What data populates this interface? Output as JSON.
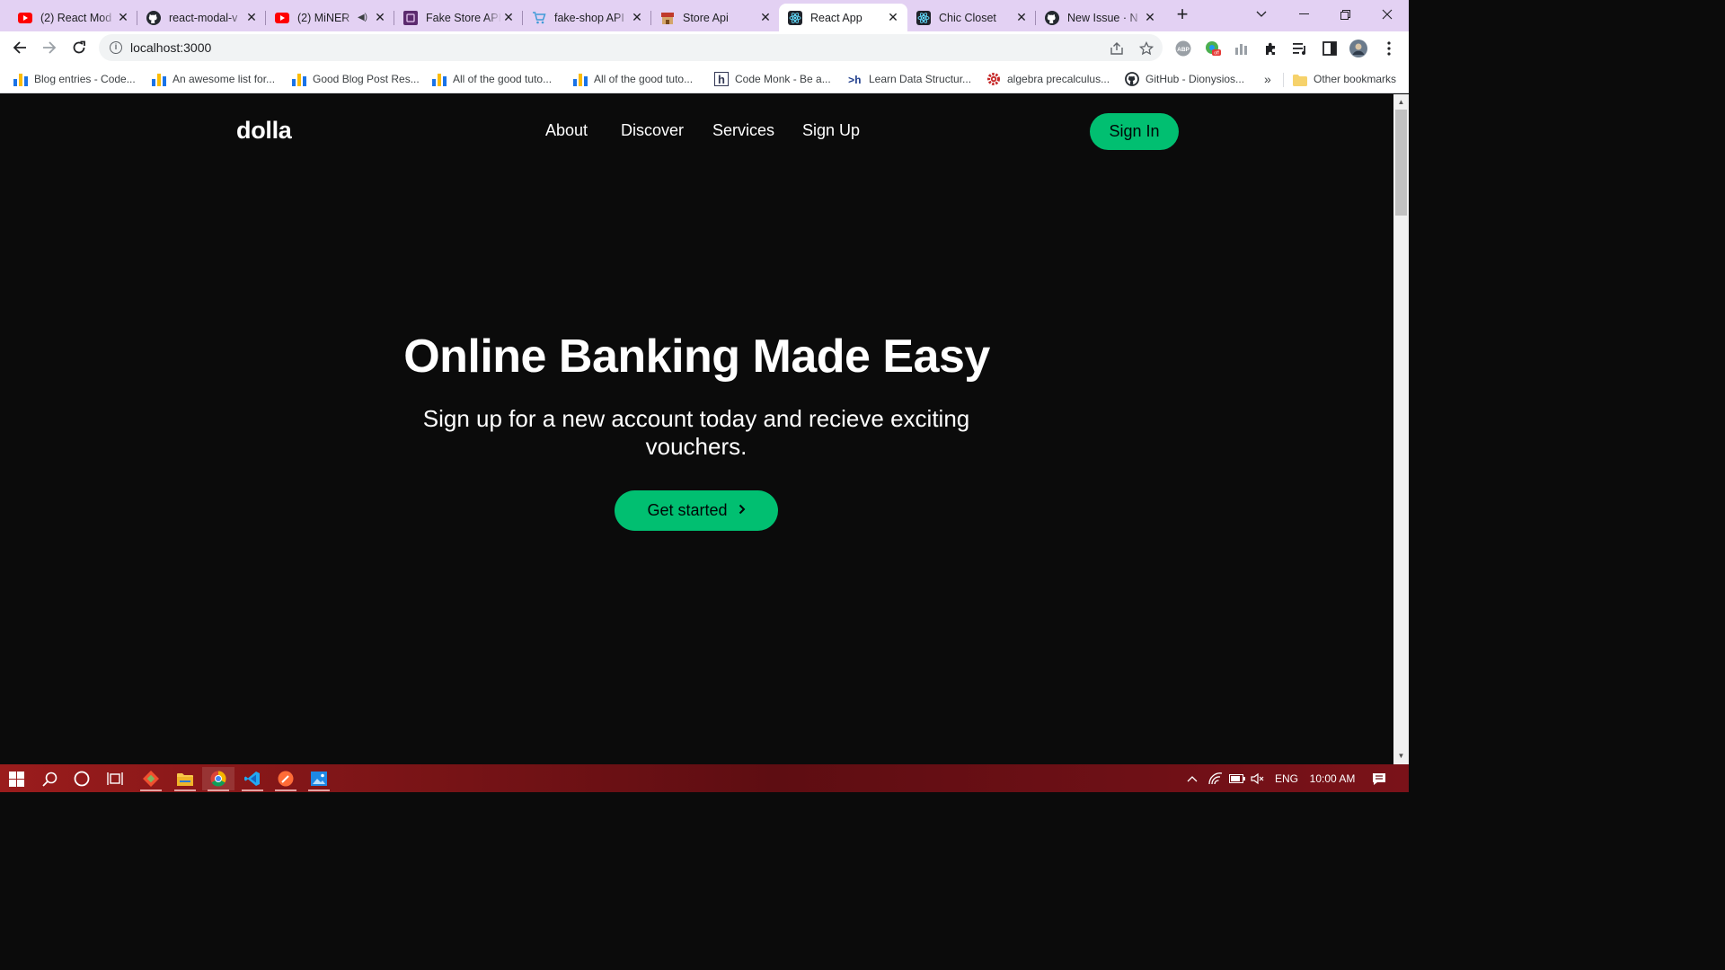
{
  "browser": {
    "tabs": [
      {
        "title": "(2) React Mod",
        "icon": "youtube-icon",
        "audio": false,
        "active": false
      },
      {
        "title": "react-modal-v",
        "icon": "github-icon",
        "audio": false,
        "active": false
      },
      {
        "title": "(2) MiNER",
        "icon": "youtube-icon",
        "audio": true,
        "active": false
      },
      {
        "title": "Fake Store API",
        "icon": "fake-store-icon",
        "audio": false,
        "active": false
      },
      {
        "title": "fake-shop API",
        "icon": "shopping-cart-icon",
        "audio": false,
        "active": false
      },
      {
        "title": "Store Api",
        "icon": "store-icon",
        "audio": false,
        "active": false
      },
      {
        "title": "React App",
        "icon": "react-icon",
        "audio": false,
        "active": true
      },
      {
        "title": "Chic Closet",
        "icon": "react-icon",
        "audio": false,
        "active": false
      },
      {
        "title": "New Issue · N",
        "icon": "github-icon",
        "audio": false,
        "active": false
      }
    ],
    "url": "localhost:3000",
    "bookmarks": [
      {
        "label": "Blog entries - Code...",
        "icon": "bar-chart-icon"
      },
      {
        "label": "An awesome list for...",
        "icon": "bar-chart-icon"
      },
      {
        "label": "Good Blog Post Res...",
        "icon": "bar-chart-icon"
      },
      {
        "label": "All of the good tuto...",
        "icon": "bar-chart-icon"
      },
      {
        "label": "All of the good tuto...",
        "icon": "bar-chart-icon"
      },
      {
        "label": "Code Monk - Be a...",
        "icon": "hackerearth-icon"
      },
      {
        "label": "Learn Data Structur...",
        "icon": "terminal-icon"
      },
      {
        "label": "algebra precalculus...",
        "icon": "gear-icon"
      },
      {
        "label": "GitHub - Dionysios...",
        "icon": "github-icon"
      }
    ],
    "bookmarks_overflow": "»",
    "other_bookmarks": "Other bookmarks"
  },
  "site": {
    "logo": "dolla",
    "nav": [
      "About",
      "Discover",
      "Services",
      "Sign Up"
    ],
    "signin": "Sign In",
    "hero": {
      "title": "Online Banking Made Easy",
      "subtitle": "Sign up for a new account today and recieve exciting vouchers.",
      "cta": "Get started",
      "cta_icon": "chevron-right-icon"
    },
    "accent": "#01bf71",
    "background": "#0b0b0b"
  },
  "taskbar": {
    "lang": "ENG",
    "time": "10:00 AM"
  }
}
